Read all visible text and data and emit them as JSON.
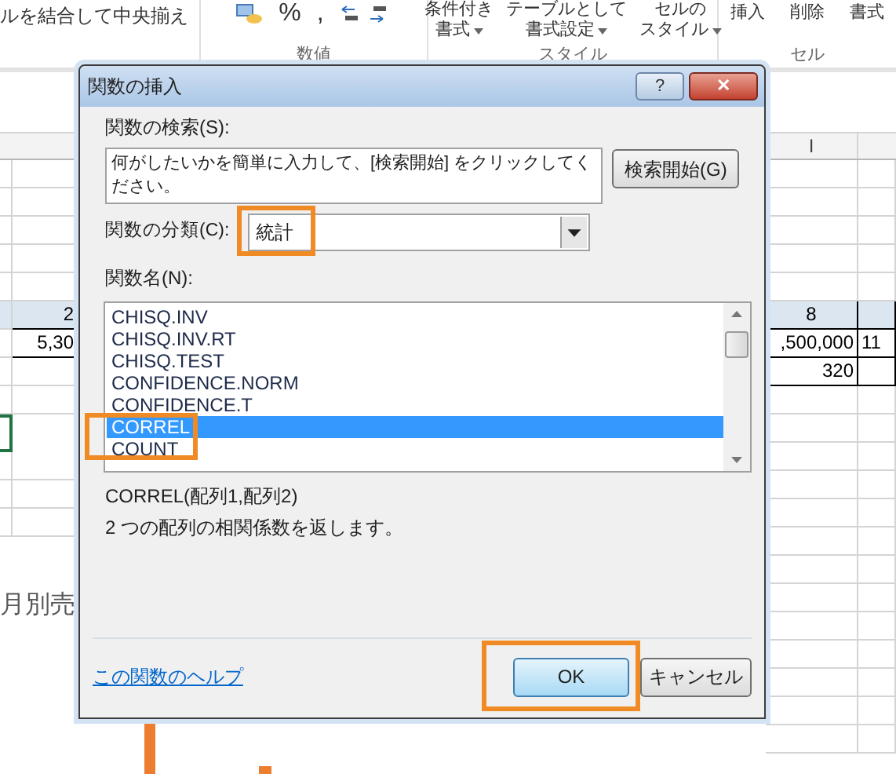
{
  "ribbon": {
    "merge_label": "ルを結合して中央揃え",
    "number_symbols": [
      "%",
      ","
    ],
    "style_buttons": [
      {
        "line1": "条件付き",
        "line2": "書式"
      },
      {
        "line1": "テーブルとして",
        "line2": "書式設定"
      },
      {
        "line1": "セルの",
        "line2": "スタイル"
      }
    ],
    "cell_buttons": [
      "挿入",
      "削除",
      "書式"
    ],
    "groups": [
      "数値",
      "スタイル",
      "セル"
    ]
  },
  "sheet": {
    "column_header": "I",
    "left_rows": [
      {
        "kind": "header",
        "text": "2"
      },
      {
        "kind": "data",
        "text": "5,30"
      }
    ],
    "right_rows": [
      {
        "kind": "header",
        "cells": [
          "8"
        ]
      },
      {
        "kind": "data",
        "cells": [
          ",500,000",
          "11"
        ]
      },
      {
        "kind": "data",
        "cells": [
          "320"
        ]
      }
    ],
    "chart_title": "月別売"
  },
  "dialog": {
    "title": "関数の挿入",
    "help_button": "?",
    "close_button": "✕",
    "search_label": "関数の検索(S):",
    "search_value": "何がしたいかを簡単に入力して、[検索開始] をクリックしてください。",
    "search_button": "検索開始(G)",
    "category_label": "関数の分類(C):",
    "category": {
      "value": "統計",
      "highlighted": true
    },
    "list_label": "関数名(N):",
    "functions": [
      {
        "name": "CHISQ.INV",
        "selected": false,
        "highlighted": false
      },
      {
        "name": "CHISQ.INV.RT",
        "selected": false,
        "highlighted": false
      },
      {
        "name": "CHISQ.TEST",
        "selected": false,
        "highlighted": false
      },
      {
        "name": "CONFIDENCE.NORM",
        "selected": false,
        "highlighted": false
      },
      {
        "name": "CONFIDENCE.T",
        "selected": false,
        "highlighted": false
      },
      {
        "name": "CORREL",
        "selected": true,
        "highlighted": true
      },
      {
        "name": "COUNT",
        "selected": false,
        "highlighted": false
      }
    ],
    "syntax": "CORREL(配列1,配列2)",
    "description": "2 つの配列の相関係数を返します。",
    "help_link": "この関数のヘルプ",
    "ok_button": {
      "label": "OK",
      "highlighted": true
    },
    "cancel_button": "キャンセル"
  }
}
